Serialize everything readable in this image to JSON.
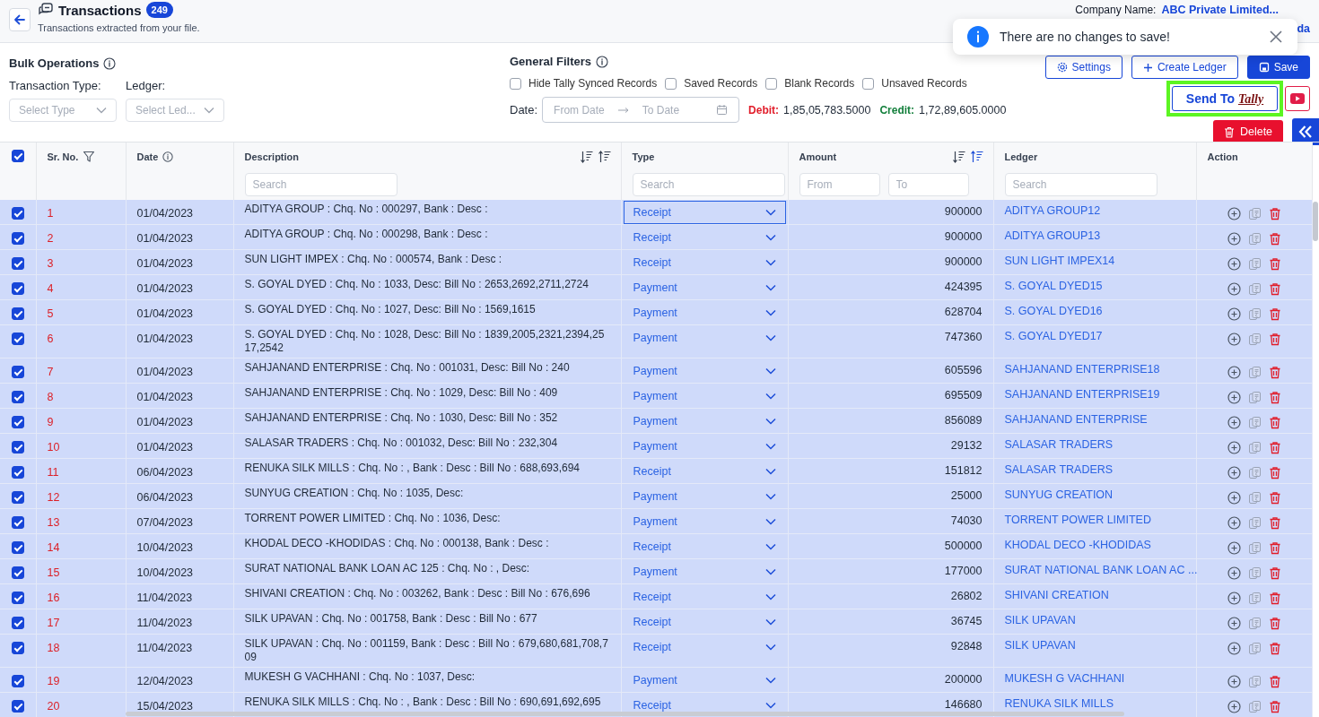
{
  "header": {
    "title": "Transactions",
    "count": "249",
    "subtitle": "Transactions extracted from your file.",
    "company_label": "Company Name:",
    "company_name": "ABC Private Limited...",
    "user_name": "da"
  },
  "toast": {
    "message": "There are no changes to save!"
  },
  "bulk_operations": {
    "title": "Bulk Operations",
    "transaction_type": {
      "label": "Transaction Type:",
      "placeholder": "Select Type"
    },
    "ledger": {
      "label": "Ledger:",
      "placeholder": "Select Led..."
    }
  },
  "general_filters": {
    "title": "General Filters",
    "checkboxes": [
      {
        "label": "Hide Tally Synced Records",
        "checked": false
      },
      {
        "label": "Saved Records",
        "checked": false
      },
      {
        "label": "Blank Records",
        "checked": false
      },
      {
        "label": "Unsaved Records",
        "checked": false
      }
    ],
    "date": {
      "label": "Date:",
      "from_placeholder": "From Date",
      "to_placeholder": "To Date"
    },
    "debit": {
      "label": "Debit:",
      "value": "1,85,05,783.5000"
    },
    "credit": {
      "label": "Credit:",
      "value": "1,72,89,605.0000"
    }
  },
  "actions": {
    "settings": "Settings",
    "create_ledger": "Create Ledger",
    "save": "Save",
    "send_to": "Send To",
    "send_to_logo": "Tally",
    "send_highlighted": true,
    "delete": "Delete"
  },
  "table": {
    "all_selected": true,
    "columns": [
      {
        "label": "Sr. No.",
        "kind": "filter"
      },
      {
        "label": "Date",
        "kind": "info"
      },
      {
        "label": "Description",
        "kind": "sort",
        "sort_ascending": false,
        "placeholder": "Search"
      },
      {
        "label": "Type",
        "kind": "plain",
        "placeholder": "Search"
      },
      {
        "label": "Amount",
        "kind": "sort",
        "sort_ascending": true,
        "from_placeholder": "From",
        "to_placeholder": "To"
      },
      {
        "label": "Ledger",
        "kind": "plain",
        "placeholder": "Search"
      },
      {
        "label": "Action",
        "kind": "plain"
      }
    ],
    "rows": [
      {
        "sr": "1",
        "date": "01/04/2023",
        "description": "ADITYA GROUP : Chq. No : 000297, Bank : Desc :",
        "type": "Receipt",
        "focused": true,
        "amount": "900000",
        "ledger": "ADITYA GROUP12",
        "selected": true
      },
      {
        "sr": "2",
        "date": "01/04/2023",
        "description": "ADITYA GROUP : Chq. No : 000298, Bank : Desc :",
        "type": "Receipt",
        "focused": false,
        "amount": "900000",
        "ledger": "ADITYA GROUP13",
        "selected": true
      },
      {
        "sr": "3",
        "date": "01/04/2023",
        "description": "SUN LIGHT IMPEX : Chq. No : 000574, Bank : Desc :",
        "type": "Receipt",
        "focused": false,
        "amount": "900000",
        "ledger": "SUN LIGHT IMPEX14",
        "selected": true
      },
      {
        "sr": "4",
        "date": "01/04/2023",
        "description": "S. GOYAL DYED : Chq. No : 1033, Desc: Bill No : 2653,2692,2711,2724",
        "type": "Payment",
        "focused": false,
        "amount": "424395",
        "ledger": "S. GOYAL DYED15",
        "selected": true
      },
      {
        "sr": "5",
        "date": "01/04/2023",
        "description": "S. GOYAL DYED : Chq. No : 1027, Desc: Bill No : 1569,1615",
        "type": "Payment",
        "focused": false,
        "amount": "628704",
        "ledger": "S. GOYAL DYED16",
        "selected": true
      },
      {
        "sr": "6",
        "date": "01/04/2023",
        "description": "S. GOYAL DYED : Chq. No : 1028, Desc: Bill No : 1839,2005,2321,2394,2517,2542",
        "type": "Payment",
        "focused": false,
        "amount": "747360",
        "ledger": "S. GOYAL DYED17",
        "selected": true
      },
      {
        "sr": "7",
        "date": "01/04/2023",
        "description": "SAHJANAND ENTERPRISE : Chq. No : 001031, Desc: Bill No : 240",
        "type": "Payment",
        "focused": false,
        "amount": "605596",
        "ledger": "SAHJANAND ENTERPRISE18",
        "selected": true
      },
      {
        "sr": "8",
        "date": "01/04/2023",
        "description": "SAHJANAND ENTERPRISE : Chq. No : 1029, Desc: Bill No : 409",
        "type": "Payment",
        "focused": false,
        "amount": "695509",
        "ledger": "SAHJANAND ENTERPRISE19",
        "selected": true
      },
      {
        "sr": "9",
        "date": "01/04/2023",
        "description": "SAHJANAND ENTERPRISE : Chq. No : 1030, Desc: Bill No : 352",
        "type": "Payment",
        "focused": false,
        "amount": "856089",
        "ledger": "SAHJANAND ENTERPRISE",
        "selected": true
      },
      {
        "sr": "10",
        "date": "01/04/2023",
        "description": "SALASAR TRADERS : Chq. No : 001032, Desc: Bill No : 232,304",
        "type": "Payment",
        "focused": false,
        "amount": "29132",
        "ledger": "SALASAR TRADERS",
        "selected": true
      },
      {
        "sr": "11",
        "date": "06/04/2023",
        "description": "RENUKA SILK MILLS : Chq. No : , Bank : Desc : Bill No : 688,693,694",
        "type": "Receipt",
        "focused": false,
        "amount": "151812",
        "ledger": "SALASAR TRADERS",
        "selected": true
      },
      {
        "sr": "12",
        "date": "06/04/2023",
        "description": "SUNYUG CREATION : Chq. No : 1035, Desc:",
        "type": "Payment",
        "focused": false,
        "amount": "25000",
        "ledger": "SUNYUG CREATION",
        "selected": true
      },
      {
        "sr": "13",
        "date": "07/04/2023",
        "description": "TORRENT POWER LIMITED : Chq. No : 1036, Desc:",
        "type": "Payment",
        "focused": false,
        "amount": "74030",
        "ledger": "TORRENT POWER LIMITED",
        "selected": true
      },
      {
        "sr": "14",
        "date": "10/04/2023",
        "description": "KHODAL DECO -KHODIDAS : Chq. No : 000138, Bank : Desc :",
        "type": "Receipt",
        "focused": false,
        "amount": "500000",
        "ledger": "KHODAL DECO -KHODIDAS",
        "selected": true
      },
      {
        "sr": "15",
        "date": "10/04/2023",
        "description": "SURAT NATIONAL BANK LOAN AC 125 : Chq. No : , Desc:",
        "type": "Payment",
        "focused": false,
        "amount": "177000",
        "ledger": "SURAT NATIONAL BANK LOAN AC ...",
        "selected": true
      },
      {
        "sr": "16",
        "date": "11/04/2023",
        "description": "SHIVANI CREATION : Chq. No : 003262, Bank : Desc : Bill No : 676,696",
        "type": "Receipt",
        "focused": false,
        "amount": "26802",
        "ledger": "SHIVANI CREATION",
        "selected": true
      },
      {
        "sr": "17",
        "date": "11/04/2023",
        "description": "SILK UPAVAN : Chq. No : 001758, Bank : Desc : Bill No : 677",
        "type": "Receipt",
        "focused": false,
        "amount": "36745",
        "ledger": "SILK UPAVAN",
        "selected": true
      },
      {
        "sr": "18",
        "date": "11/04/2023",
        "description": "SILK UPAVAN : Chq. No : 001159, Bank : Desc : Bill No : 679,680,681,708,709",
        "type": "Receipt",
        "focused": false,
        "amount": "92848",
        "ledger": "SILK UPAVAN",
        "selected": true
      },
      {
        "sr": "19",
        "date": "12/04/2023",
        "description": "MUKESH G VACHHANI : Chq. No : 1037, Desc:",
        "type": "Payment",
        "focused": false,
        "amount": "200000",
        "ledger": "MUKESH G VACHHANI",
        "selected": true
      },
      {
        "sr": "20",
        "date": "15/04/2023",
        "description": "RENUKA SILK MILLS : Chq. No : , Bank : Desc : Bill No : 690,691,692,695",
        "type": "Receipt",
        "focused": false,
        "amount": "146680",
        "ledger": "RENUKA SILK MILLS",
        "selected": true
      }
    ]
  }
}
